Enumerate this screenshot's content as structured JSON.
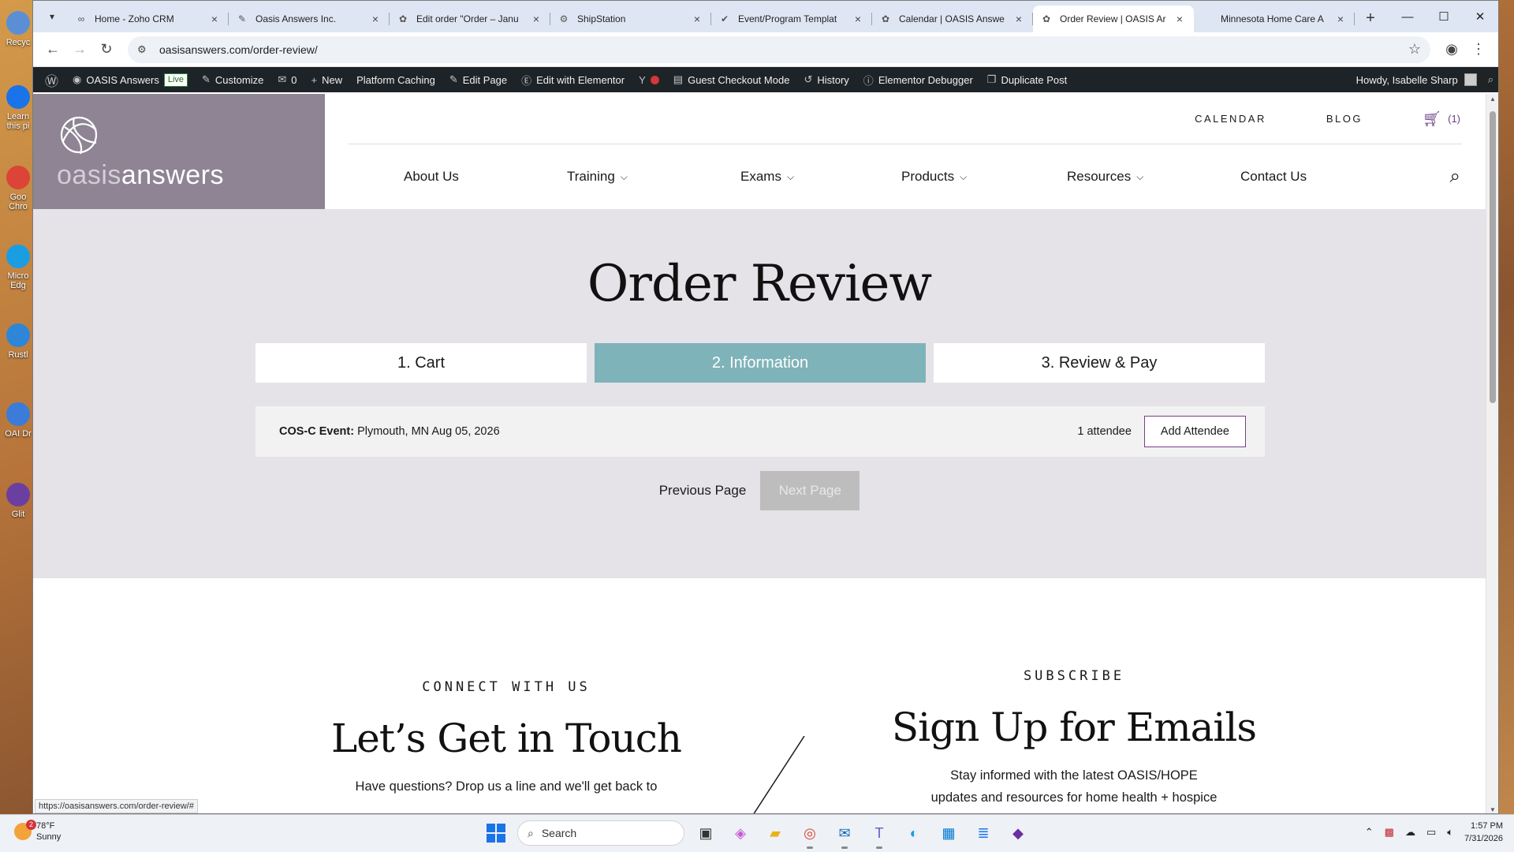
{
  "desktop": {
    "icons": [
      {
        "label": "Recyc",
        "color": "#5a8fd6"
      },
      {
        "label": "Learn this pi",
        "color": "#1a73e8"
      },
      {
        "label": "Goo Chro",
        "color": "#db4437"
      },
      {
        "label": "Micro Edg",
        "color": "#1b9de2"
      },
      {
        "label": "Rustl",
        "color": "#2f86d6"
      },
      {
        "label": "OAI Dr",
        "color": "#3c7bd8"
      },
      {
        "label": "Glit",
        "color": "#6b3fa0"
      }
    ]
  },
  "browser": {
    "tabs": [
      {
        "title": "Home - Zoho CRM",
        "icon": "zoho-icon",
        "glyph": "∞",
        "active": false
      },
      {
        "title": "Oasis Answers Inc.",
        "icon": "leaf-icon",
        "glyph": "✎",
        "active": false
      },
      {
        "title": "Edit order \"Order – Janu",
        "icon": "oasis-icon",
        "glyph": "✿",
        "active": false
      },
      {
        "title": "ShipStation",
        "icon": "gear-icon",
        "glyph": "⚙",
        "active": false
      },
      {
        "title": "Event/Program Templat",
        "icon": "check-icon",
        "glyph": "✔",
        "active": false
      },
      {
        "title": "Calendar | OASIS Answe",
        "icon": "oasis-icon",
        "glyph": "✿",
        "active": false
      },
      {
        "title": "Order Review | OASIS Ar",
        "icon": "oasis-icon",
        "glyph": "✿",
        "active": true
      },
      {
        "title": "Minnesota Home Care A",
        "icon": "blank-icon",
        "glyph": "",
        "active": false
      }
    ],
    "url": "oasisanswers.com/order-review/"
  },
  "adminbar": {
    "items": [
      {
        "label": "OASIS Answers",
        "icon": "dashboard-icon",
        "glyph": "◉"
      },
      {
        "label": "Customize",
        "icon": "brush-icon",
        "glyph": "✎"
      },
      {
        "label": "0",
        "icon": "comment-icon",
        "glyph": "✉"
      },
      {
        "label": "New",
        "icon": "plus-icon",
        "glyph": "+"
      },
      {
        "label": "Platform Caching",
        "icon": "",
        "glyph": ""
      },
      {
        "label": "Edit Page",
        "icon": "pencil-icon",
        "glyph": "✎"
      },
      {
        "label": "Edit with Elementor",
        "icon": "elementor-icon",
        "glyph": "Ⓔ"
      },
      {
        "label": "",
        "icon": "yoast-icon",
        "glyph": "Y"
      },
      {
        "label": "Guest Checkout Mode",
        "icon": "card-icon",
        "glyph": "▤"
      },
      {
        "label": "History",
        "icon": "history-icon",
        "glyph": "↺"
      },
      {
        "label": "Elementor Debugger",
        "icon": "info-icon",
        "glyph": "ⓘ"
      },
      {
        "label": "Duplicate Post",
        "icon": "copy-icon",
        "glyph": "❐"
      }
    ],
    "live_badge": "Live",
    "howdy": "Howdy, Isabelle Sharp"
  },
  "site": {
    "logo": {
      "oasis": "oasis",
      "answers": "answers"
    },
    "top_links": [
      "CALENDAR",
      "BLOG"
    ],
    "cart_count": "(1)",
    "nav": [
      {
        "label": "About Us",
        "dropdown": false
      },
      {
        "label": "Training",
        "dropdown": true
      },
      {
        "label": "Exams",
        "dropdown": true
      },
      {
        "label": "Products",
        "dropdown": true
      },
      {
        "label": "Resources",
        "dropdown": true
      },
      {
        "label": "Contact Us",
        "dropdown": false
      }
    ]
  },
  "page": {
    "title": "Order Review",
    "steps": [
      {
        "label": "1. Cart",
        "active": false
      },
      {
        "label": "2. Information",
        "active": true
      },
      {
        "label": "3. Review & Pay",
        "active": false
      }
    ],
    "event": {
      "label": "COS-C Event:",
      "detail": "Plymouth, MN Aug 05, 2026",
      "attendees": "1 attendee",
      "add_button": "Add Attendee"
    },
    "prev_page": "Previous Page",
    "next_page": "Next Page"
  },
  "footer": {
    "connect": {
      "eyebrow": "CONNECT WITH US",
      "heading": "Let’s Get in Touch",
      "text": "Have questions? Drop us a line and we'll get back to"
    },
    "subscribe": {
      "eyebrow": "SUBSCRIBE",
      "heading": "Sign Up for Emails",
      "text1": "Stay informed with the latest OASIS/HOPE",
      "text2": "updates and resources for home health + hospice"
    }
  },
  "status_url": "https://oasisanswers.com/order-review/#",
  "taskbar": {
    "weather": {
      "temp": "78°F",
      "condition": "Sunny",
      "badge": "2"
    },
    "search": "Search",
    "apps": [
      {
        "name": "task-view-icon",
        "glyph": "▣",
        "color": "#333",
        "running": false
      },
      {
        "name": "copilot-icon",
        "glyph": "◈",
        "color": "#c35bd6",
        "running": false
      },
      {
        "name": "file-explorer-icon",
        "glyph": "▰",
        "color": "#e8b21a",
        "running": false
      },
      {
        "name": "chrome-icon",
        "glyph": "◎",
        "color": "#db4437",
        "running": true
      },
      {
        "name": "outlook-icon",
        "glyph": "✉",
        "color": "#0f6cbd",
        "running": true
      },
      {
        "name": "teams-icon",
        "glyph": "T",
        "color": "#5b5fc7",
        "running": true
      },
      {
        "name": "edge-icon",
        "glyph": "◐",
        "color": "#1b9de2",
        "running": false
      },
      {
        "name": "store-icon",
        "glyph": "▦",
        "color": "#0078d4",
        "running": false
      },
      {
        "name": "notepad-icon",
        "glyph": "≣",
        "color": "#1a73e8",
        "running": false
      },
      {
        "name": "app-icon",
        "glyph": "◆",
        "color": "#6b2fa0",
        "running": false
      }
    ],
    "time": "1:57 PM",
    "date": "7/31/2026"
  },
  "colors": {
    "step_active": "#7eb3b9",
    "logo_bg": "#8e8494",
    "hero_bg": "#e5e3e8",
    "accent_purple": "#7a3e86"
  }
}
